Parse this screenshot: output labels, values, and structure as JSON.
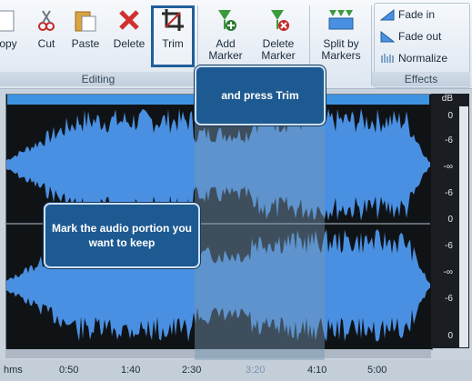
{
  "ribbon": {
    "buttons": {
      "copy": "opy",
      "cut": "Cut",
      "paste": "Paste",
      "delete": "Delete",
      "trim": "Trim",
      "add_marker": "Add Marker",
      "delete_marker": "Delete Marker",
      "split": "Split by Markers"
    },
    "groups": {
      "editing": "Editing",
      "effects": "Effects"
    },
    "effects": [
      "Fade in",
      "Fade out",
      "Normalize"
    ]
  },
  "callouts": {
    "trim": "and press Trim",
    "mark": "Mark the audio portion you want to keep"
  },
  "scale": {
    "unit": "dB",
    "labels": [
      "0",
      "-6",
      "-∞",
      "-6",
      "0",
      "-6",
      "-∞",
      "-6",
      "0"
    ]
  },
  "timeline": {
    "labels": [
      "hms",
      "0:50",
      "1:40",
      "2:30",
      "3:20",
      "4:10",
      "5:00"
    ]
  },
  "colors": {
    "waveform": "#4a90e2",
    "callout": "#1e5a92"
  }
}
